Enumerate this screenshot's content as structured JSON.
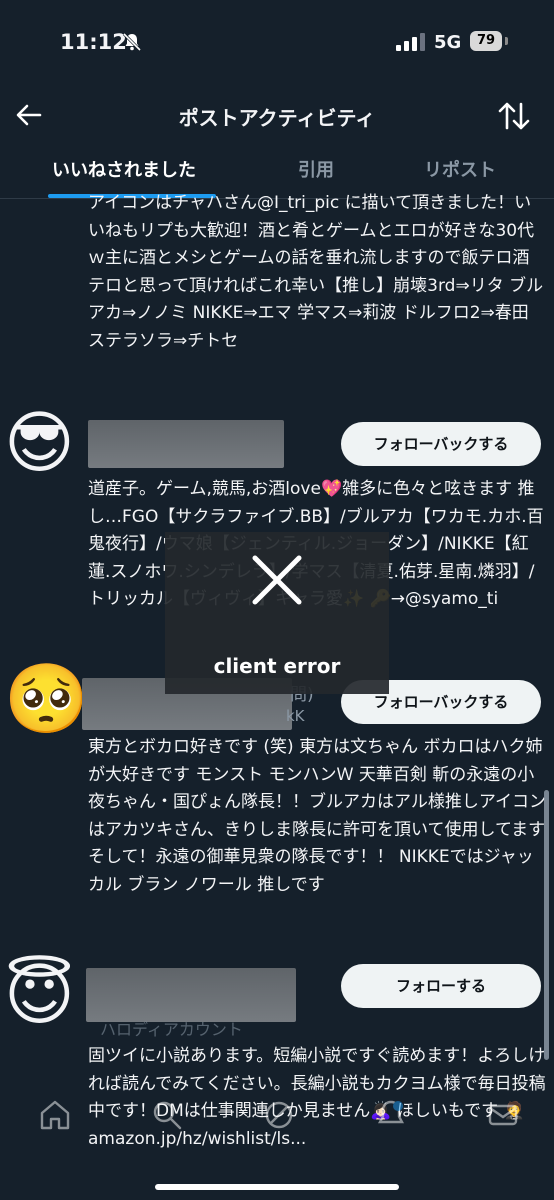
{
  "status_bar": {
    "time": "11:12",
    "network": "5G",
    "battery": "79"
  },
  "header": {
    "title": "ポストアクティビティ"
  },
  "tabs": [
    {
      "label": "いいねされました"
    },
    {
      "label": "引用"
    },
    {
      "label": "リポスト"
    }
  ],
  "users": [
    {
      "bio": "アイコンはチャハさん@I_tri_pic に描いて頂きました！いいねもリプも大歓迎！酒と肴とゲームとエロが好きな30代ｗ主に酒とメシとゲームの話を垂れ流しますので飯テロ酒テロと思って頂ければこれ幸い【推し】崩壊3rd⇒リタ ブルアカ⇒ノノミ NIKKE⇒エマ 学マス⇒莉波 ドルフロ2⇒春田 ステラソラ⇒チトセ"
    },
    {
      "avatar": "😎",
      "follow_label": "フォローバックする",
      "bio": "道産子。ゲーム,競馬,お酒love💖雑多に色々と呟きます 推し…FGO【サクラファイブ.BB】/ブルアカ【ワカモ.カホ.百鬼夜行】/ウマ娘【ジェンティル.ジョーダン】/NIKKE【紅蓮.スノホワ.シンデレラ】/学マス【清夏.佑芽.星南.燐羽】/トリッカル【ヴィヴィ】キャラ愛✨ 🔑→@syamo_ti"
    },
    {
      "avatar": "🥺",
      "follow_label": "フォローバックする",
      "partial_name": "問)",
      "partial_handle": "kK",
      "bio": "東方とボカロ好きです (笑) 東方は文ちゃん ボカロはハク姉が大好きです モンスト モンハンＷ 天華百剣 斬の永遠の小夜ちゃん・国ぴょん隊長！！ブルアカはアル様推しアイコンはアカツキさん、きりしま隊長に許可を頂いて使用してます そして！永遠の御華見衆の隊長です！！ NIKKEではジャッカル ブラン ノワール 推しです"
    },
    {
      "avatar": "😇",
      "follow_label": "フォローする",
      "partial_handle": "ハロディアカウント",
      "bio": "固ツイに小説あります。短編小説ですぐ読めます！よろしければ読んでみてください。長編小説もカクヨム様で毎日投稿中です！DMは仕事関連しか見ません🙇🏻‍♀️ ほしいもです 🤵 amazon.jp/hz/wishlist/ls..."
    }
  ],
  "error": {
    "message": "client error"
  },
  "colors": {
    "background": "#15202b",
    "accent": "#1d9bf0",
    "button": "#eff3f4"
  }
}
